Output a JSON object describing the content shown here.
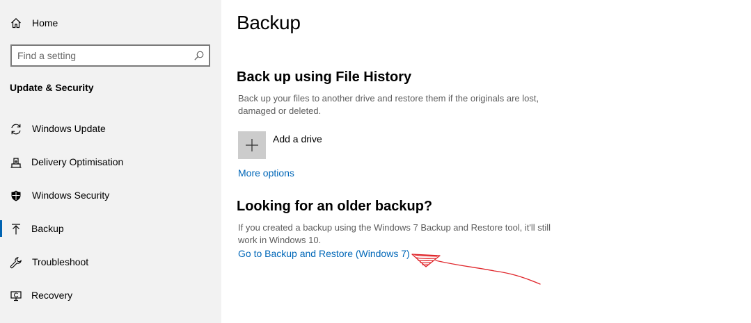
{
  "sidebar": {
    "home_label": "Home",
    "search": {
      "placeholder": "Find a setting"
    },
    "section_title": "Update & Security",
    "items": [
      {
        "label": "Windows Update",
        "icon": "sync-icon"
      },
      {
        "label": "Delivery Optimisation",
        "icon": "delivery-optimisation-icon"
      },
      {
        "label": "Windows Security",
        "icon": "shield-icon"
      },
      {
        "label": "Backup",
        "icon": "backup-arrow-icon",
        "active": true
      },
      {
        "label": "Troubleshoot",
        "icon": "wrench-icon"
      },
      {
        "label": "Recovery",
        "icon": "recovery-icon"
      }
    ]
  },
  "main": {
    "title": "Backup",
    "file_history": {
      "heading": "Back up using File History",
      "description": "Back up your files to another drive and restore them if the originals are lost, damaged or deleted.",
      "add_drive_label": "Add a drive",
      "more_options_label": "More options"
    },
    "older_backup": {
      "heading": "Looking for an older backup?",
      "description": "If you created a backup using the Windows 7 Backup and Restore tool, it'll still work in Windows 10.",
      "link_label": "Go to Backup and Restore (Windows 7)"
    }
  },
  "colors": {
    "accent": "#0067b8",
    "active_indicator": "#0063b1",
    "sidebar_bg": "#f2f2f2",
    "annotation": "#e0262b"
  }
}
